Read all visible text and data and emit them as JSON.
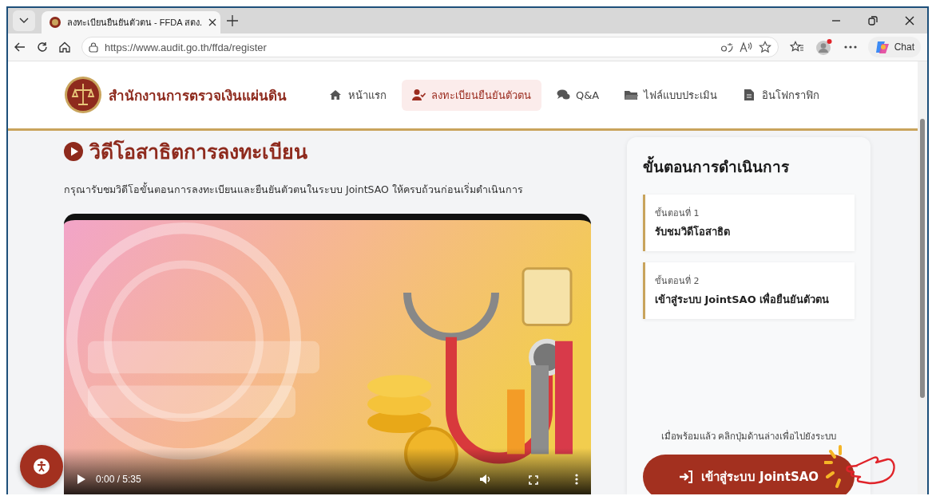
{
  "browser": {
    "tab_title": "ลงทะเบียนยืนยันตัวตน - FFDA สตง.",
    "url": "https://www.audit.go.th/ffda/register",
    "chat_label": "Chat"
  },
  "header": {
    "site_name": "สำนักงานการตรวจเงินแผ่นดิน",
    "nav": [
      {
        "label": "หน้าแรก",
        "selected": false
      },
      {
        "label": "ลงทะเบียนยืนยันตัวตน",
        "selected": true
      },
      {
        "label": "Q&A",
        "selected": false
      },
      {
        "label": "ไฟล์แบบประเมิน",
        "selected": false
      },
      {
        "label": "อินโฟกราฟิก",
        "selected": false
      }
    ]
  },
  "video": {
    "title": "วิดีโอสาธิตการลงทะเบียน",
    "description": "กรุณารับชมวิดีโอขั้นตอนการลงทะเบียนและยืนยันตัวตนในระบบ JointSAO ให้ครบถ้วนก่อนเริ่มดำเนินการ",
    "time": "0:00 / 5:35"
  },
  "steps": {
    "title": "ขั้นตอนการดำเนินการ",
    "items": [
      {
        "label": "ขั้นตอนที่ 1",
        "text": "รับชมวิดีโอสาธิต"
      },
      {
        "label": "ขั้นตอนที่ 2",
        "text": "เข้าสู่ระบบ JointSAO เพื่อยืนยันตัวตน"
      }
    ],
    "hint": "เมื่อพร้อมแล้ว คลิกปุ่มด้านล่างเพื่อไปยังระบบ",
    "button": "เข้าสู่ระบบ JointSAO"
  }
}
